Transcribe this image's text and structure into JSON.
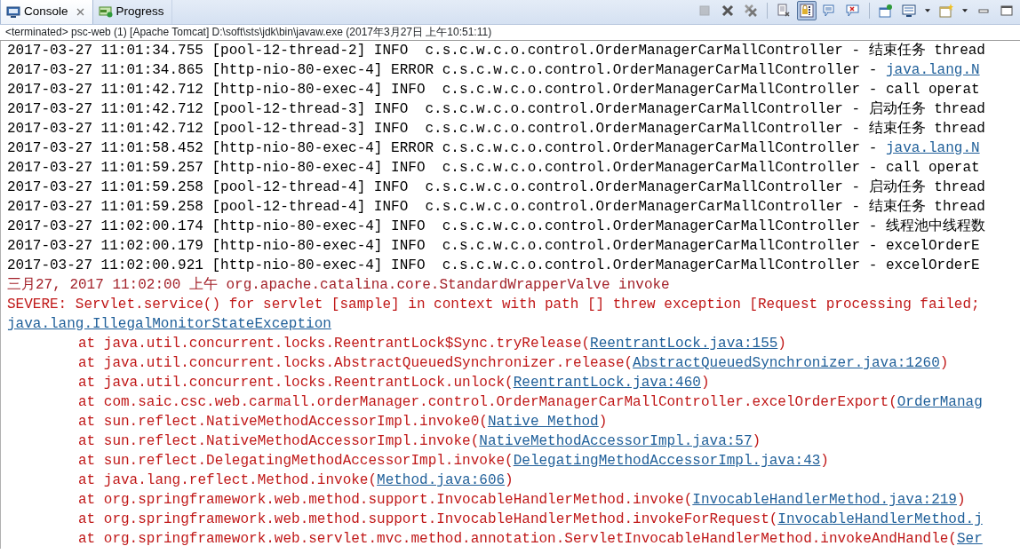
{
  "tabs": [
    {
      "label": "Console",
      "selected": true,
      "closable": true
    },
    {
      "label": "Progress",
      "selected": false,
      "closable": false
    }
  ],
  "toolbar_groups": [
    [
      {
        "kind": "terminate",
        "pressed": false,
        "disabled": true,
        "menu": false
      },
      {
        "kind": "remove",
        "pressed": false,
        "disabled": false,
        "menu": false
      },
      {
        "kind": "remove-all",
        "pressed": false,
        "disabled": false,
        "menu": false
      }
    ],
    [
      {
        "kind": "clear",
        "pressed": false,
        "disabled": false,
        "menu": false
      },
      {
        "kind": "scroll-lock",
        "pressed": true,
        "disabled": false,
        "menu": false
      },
      {
        "kind": "show-stdout",
        "pressed": false,
        "disabled": false,
        "menu": false
      },
      {
        "kind": "show-stderr",
        "pressed": false,
        "disabled": false,
        "menu": false
      }
    ],
    [
      {
        "kind": "pin",
        "pressed": false,
        "disabled": false,
        "menu": false
      },
      {
        "kind": "display",
        "pressed": false,
        "disabled": false,
        "menu": true
      },
      {
        "kind": "new-console",
        "pressed": false,
        "disabled": false,
        "menu": true
      },
      {
        "kind": "minimize",
        "pressed": false,
        "disabled": false,
        "menu": false
      },
      {
        "kind": "maximize",
        "pressed": false,
        "disabled": false,
        "menu": false
      }
    ]
  ],
  "process_label": "<terminated> psc-web (1) [Apache Tomcat] D:\\soft\\sts\\jdk\\bin\\javaw.exe (2017年3月27日 上午10:51:11)",
  "lines": [
    {
      "kind": "stdout",
      "text": "2017-03-27 11:01:34.755 [pool-12-thread-2] INFO  c.s.c.w.c.o.control.OrderManagerCarMallController - 结束任务 thread"
    },
    {
      "kind": "stdout",
      "text": "2017-03-27 11:01:34.865 [http-nio-80-exec-4] ERROR c.s.c.w.c.o.control.OrderManagerCarMallController - ",
      "link": "java.lang.N"
    },
    {
      "kind": "stdout",
      "text": "2017-03-27 11:01:42.712 [http-nio-80-exec-4] INFO  c.s.c.w.c.o.control.OrderManagerCarMallController - call operat"
    },
    {
      "kind": "stdout",
      "text": "2017-03-27 11:01:42.712 [pool-12-thread-3] INFO  c.s.c.w.c.o.control.OrderManagerCarMallController - 启动任务 thread"
    },
    {
      "kind": "stdout",
      "text": "2017-03-27 11:01:42.712 [pool-12-thread-3] INFO  c.s.c.w.c.o.control.OrderManagerCarMallController - 结束任务 thread"
    },
    {
      "kind": "stdout",
      "text": "2017-03-27 11:01:58.452 [http-nio-80-exec-4] ERROR c.s.c.w.c.o.control.OrderManagerCarMallController - ",
      "link": "java.lang.N"
    },
    {
      "kind": "stdout",
      "text": "2017-03-27 11:01:59.257 [http-nio-80-exec-4] INFO  c.s.c.w.c.o.control.OrderManagerCarMallController - call operat"
    },
    {
      "kind": "stdout",
      "text": "2017-03-27 11:01:59.258 [pool-12-thread-4] INFO  c.s.c.w.c.o.control.OrderManagerCarMallController - 启动任务 thread"
    },
    {
      "kind": "stdout",
      "text": "2017-03-27 11:01:59.258 [pool-12-thread-4] INFO  c.s.c.w.c.o.control.OrderManagerCarMallController - 结束任务 thread"
    },
    {
      "kind": "stdout",
      "text": "2017-03-27 11:02:00.174 [http-nio-80-exec-4] INFO  c.s.c.w.c.o.control.OrderManagerCarMallController - 线程池中线程数"
    },
    {
      "kind": "stdout",
      "text": "2017-03-27 11:02:00.179 [http-nio-80-exec-4] INFO  c.s.c.w.c.o.control.OrderManagerCarMallController - excelOrderE"
    },
    {
      "kind": "stdout",
      "text": "2017-03-27 11:02:00.921 [http-nio-80-exec-4] INFO  c.s.c.w.c.o.control.OrderManagerCarMallController - excelOrderE"
    },
    {
      "kind": "stderr-header",
      "text": "三月27, 2017 11:02:00 上午 org.apache.catalina.core.StandardWrapperValve invoke"
    },
    {
      "kind": "stderr",
      "text": "SEVERE: Servlet.service() for servlet [sample] in context with path [] threw exception [Request processing failed;"
    },
    {
      "kind": "stderr",
      "link": "java.lang.IllegalMonitorStateException"
    },
    {
      "kind": "frame",
      "text": "at java.util.concurrent.locks.ReentrantLock$Sync.tryRelease(",
      "link": "ReentrantLock.java:155",
      "after": ")"
    },
    {
      "kind": "frame",
      "text": "at java.util.concurrent.locks.AbstractQueuedSynchronizer.release(",
      "link": "AbstractQueuedSynchronizer.java:1260",
      "after": ")"
    },
    {
      "kind": "frame",
      "text": "at java.util.concurrent.locks.ReentrantLock.unlock(",
      "link": "ReentrantLock.java:460",
      "after": ")"
    },
    {
      "kind": "frame",
      "text": "at com.saic.csc.web.carmall.orderManager.control.OrderManagerCarMallController.excelOrderExport(",
      "link": "OrderManag"
    },
    {
      "kind": "frame",
      "text": "at sun.reflect.NativeMethodAccessorImpl.invoke0(",
      "link": "Native Method",
      "after": ")"
    },
    {
      "kind": "frame",
      "text": "at sun.reflect.NativeMethodAccessorImpl.invoke(",
      "link": "NativeMethodAccessorImpl.java:57",
      "after": ")"
    },
    {
      "kind": "frame",
      "text": "at sun.reflect.DelegatingMethodAccessorImpl.invoke(",
      "link": "DelegatingMethodAccessorImpl.java:43",
      "after": ")"
    },
    {
      "kind": "frame",
      "text": "at java.lang.reflect.Method.invoke(",
      "link": "Method.java:606",
      "after": ")"
    },
    {
      "kind": "frame",
      "text": "at org.springframework.web.method.support.InvocableHandlerMethod.invoke(",
      "link": "InvocableHandlerMethod.java:219",
      "after": ")"
    },
    {
      "kind": "frame",
      "text": "at org.springframework.web.method.support.InvocableHandlerMethod.invokeForRequest(",
      "link": "InvocableHandlerMethod.j"
    },
    {
      "kind": "frame",
      "text": "at org.springframework.web.servlet.mvc.method.annotation.ServletInvocableHandlerMethod.invokeAndHandle(",
      "link": "Ser"
    }
  ]
}
